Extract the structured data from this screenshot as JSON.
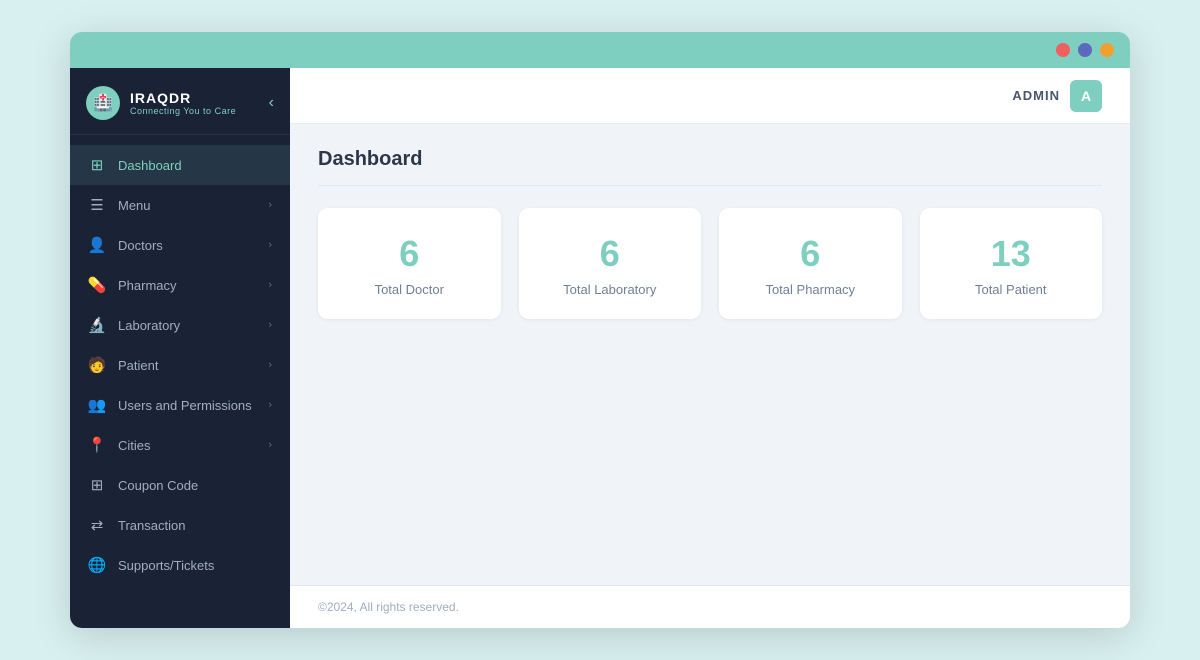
{
  "browser": {
    "dots": [
      "red",
      "blue",
      "orange"
    ]
  },
  "sidebar": {
    "logo": {
      "title": "IRAQDR",
      "subtitle": "Connecting You to Care",
      "icon_emoji": "🏥"
    },
    "nav_items": [
      {
        "id": "dashboard",
        "label": "Dashboard",
        "icon": "⊞",
        "active": true,
        "has_chevron": false
      },
      {
        "id": "menu",
        "label": "Menu",
        "icon": "☰",
        "active": false,
        "has_chevron": true
      },
      {
        "id": "doctors",
        "label": "Doctors",
        "icon": "👤",
        "active": false,
        "has_chevron": true
      },
      {
        "id": "pharmacy",
        "label": "Pharmacy",
        "icon": "💊",
        "active": false,
        "has_chevron": true
      },
      {
        "id": "laboratory",
        "label": "Laboratory",
        "icon": "🔬",
        "active": false,
        "has_chevron": true
      },
      {
        "id": "patient",
        "label": "Patient",
        "icon": "🧑",
        "active": false,
        "has_chevron": true
      },
      {
        "id": "users-permissions",
        "label": "Users and Permissions",
        "icon": "👥",
        "active": false,
        "has_chevron": true
      },
      {
        "id": "cities",
        "label": "Cities",
        "icon": "📍",
        "active": false,
        "has_chevron": true
      },
      {
        "id": "coupon-code",
        "label": "Coupon Code",
        "icon": "⊞",
        "active": false,
        "has_chevron": false
      },
      {
        "id": "transaction",
        "label": "Transaction",
        "icon": "⇄",
        "active": false,
        "has_chevron": false
      },
      {
        "id": "supports",
        "label": "Supports/Tickets",
        "icon": "🌐",
        "active": false,
        "has_chevron": false
      }
    ]
  },
  "topbar": {
    "user_label": "ADMIN",
    "user_avatar_letter": "A"
  },
  "page": {
    "title": "Dashboard"
  },
  "stats": [
    {
      "id": "total-doctor",
      "value": "6",
      "label": "Total Doctor"
    },
    {
      "id": "total-laboratory",
      "value": "6",
      "label": "Total Laboratory"
    },
    {
      "id": "total-pharmacy",
      "value": "6",
      "label": "Total Pharmacy"
    },
    {
      "id": "total-patient",
      "value": "13",
      "label": "Total Patient"
    }
  ],
  "footer": {
    "text": "©2024, All rights reserved."
  }
}
